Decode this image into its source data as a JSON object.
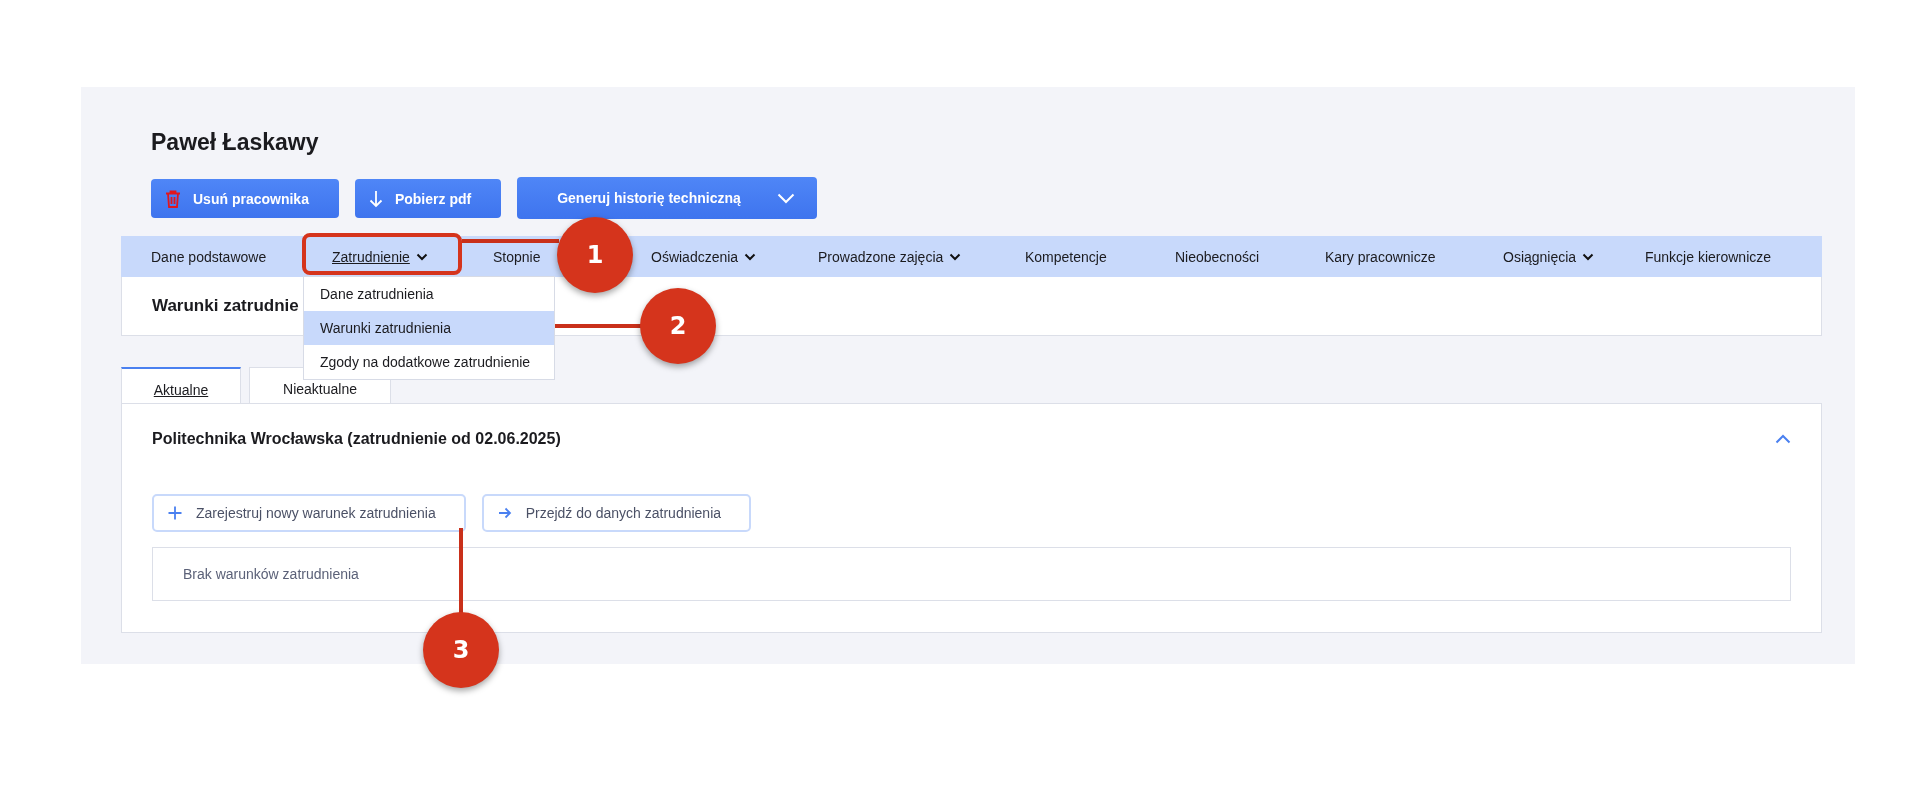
{
  "employee": {
    "name": "Paweł Łaskawy"
  },
  "actions": [
    {
      "kind": "delete",
      "label": "Usuń pracownika"
    },
    {
      "kind": "download",
      "label": "Pobierz pdf"
    },
    {
      "kind": "menu",
      "label": "Generuj historię techniczną"
    }
  ],
  "nav": {
    "items": [
      {
        "label": "Dane podstawowe",
        "has_menu": false,
        "selected": false
      },
      {
        "label": "Zatrudnienie",
        "has_menu": true,
        "selected": true
      },
      {
        "label": "Stopnie",
        "has_menu": false,
        "selected": false
      },
      {
        "label": "Oświadczenia",
        "has_menu": true,
        "selected": false
      },
      {
        "label": "Prowadzone zajęcia",
        "has_menu": true,
        "selected": false
      },
      {
        "label": "Kompetencje",
        "has_menu": false,
        "selected": false
      },
      {
        "label": "Nieobecności",
        "has_menu": false,
        "selected": false
      },
      {
        "label": "Kary pracownicze",
        "has_menu": false,
        "selected": false
      },
      {
        "label": "Osiągnięcia",
        "has_menu": true,
        "selected": false
      },
      {
        "label": "Funkcje kierownicze",
        "has_menu": false,
        "selected": false
      }
    ]
  },
  "dropdown": {
    "items": [
      {
        "label": "Dane zatrudnienia",
        "selected": false
      },
      {
        "label": "Warunki zatrudnienia",
        "selected": true
      },
      {
        "label": "Zgody na dodatkowe zatrudnienie",
        "selected": false
      }
    ]
  },
  "section_title": "Warunki zatrudnie",
  "tabs": [
    {
      "label": "Aktualne",
      "selected": true
    },
    {
      "label": "Nieaktualne",
      "selected": false
    }
  ],
  "employment": {
    "title": "Politechnika Wrocławska (zatrudnienie od 02.06.2025)",
    "expanded": true,
    "buttons": [
      {
        "kind": "add",
        "label": "Zarejestruj nowy warunek zatrudnienia"
      },
      {
        "kind": "go",
        "label": "Przejdź do danych zatrudnienia"
      }
    ],
    "empty_text": "Brak warunków zatrudnienia"
  },
  "callouts": [
    {
      "number": "1"
    },
    {
      "number": "2"
    },
    {
      "number": "3"
    }
  ]
}
